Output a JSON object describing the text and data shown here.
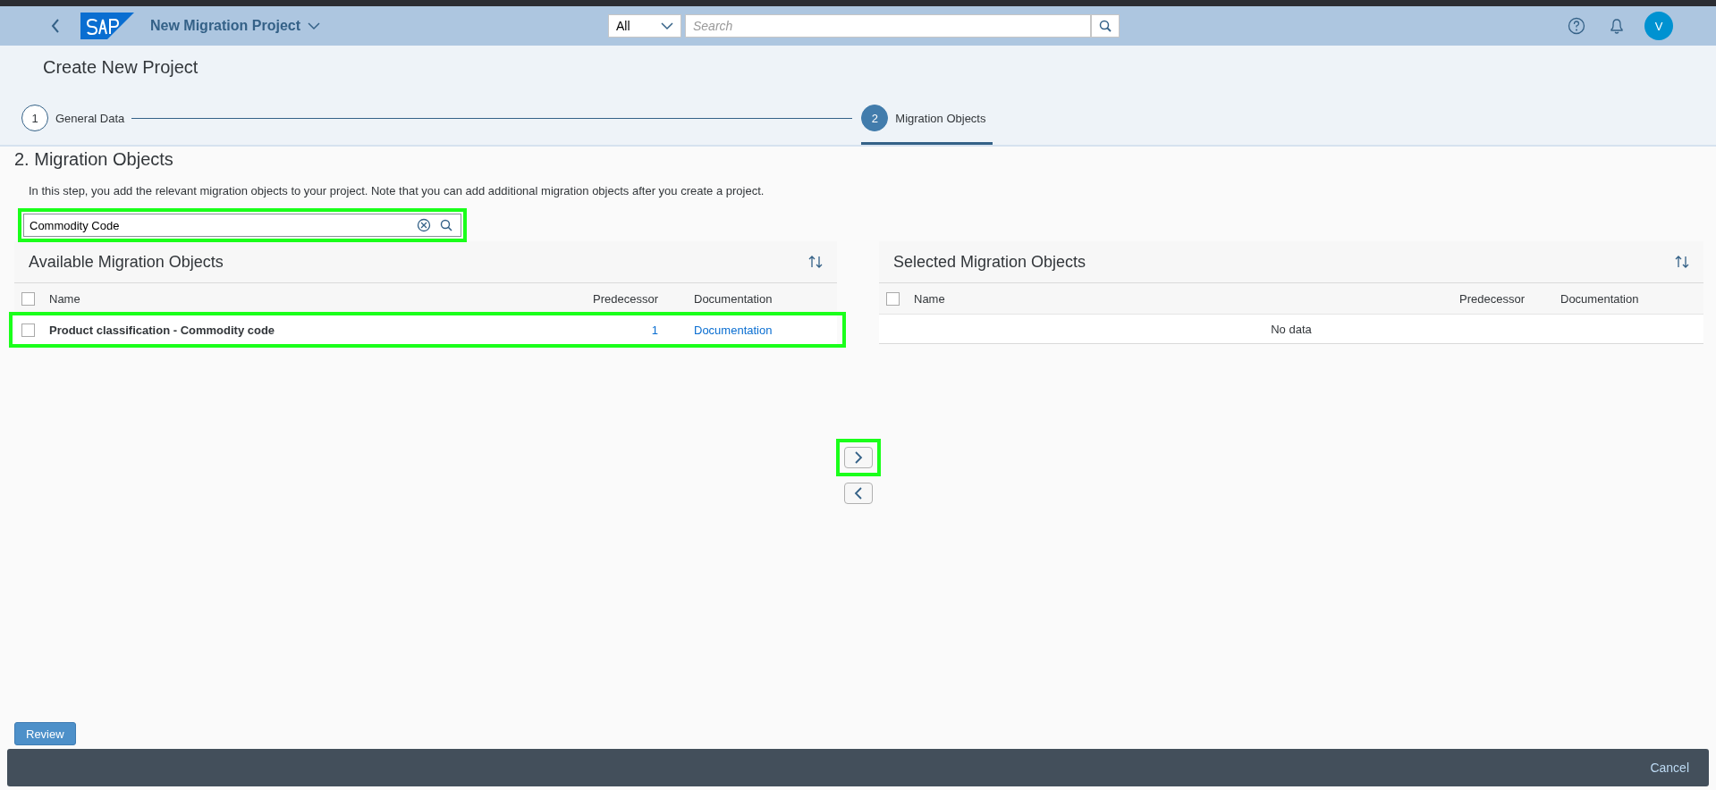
{
  "shell": {
    "title": "New Migration Project",
    "search_scope": "All",
    "search_placeholder": "Search",
    "avatar": "V"
  },
  "page_title": "Create New Project",
  "steps": [
    {
      "number": "1",
      "label": "General Data",
      "selected": false
    },
    {
      "number": "2",
      "label": "Migration Objects",
      "selected": true
    }
  ],
  "section": {
    "title": "2. Migration Objects",
    "description": "In this step, you add the relevant migration objects to your project. Note that you can add additional migration objects after you create a project."
  },
  "filter": {
    "value": "Commodity Code",
    "highlighted": true
  },
  "available": {
    "title": "Available Migration Objects",
    "columns": [
      "Name",
      "Predecessor",
      "Documentation"
    ],
    "all_checked": false,
    "rows": [
      {
        "name": "Product classification - Commodity code",
        "predecessor": "1",
        "documentation": "Documentation",
        "checked": false,
        "highlighted": true
      }
    ]
  },
  "selected": {
    "title": "Selected Migration Objects",
    "columns": [
      "Name",
      "Predecessor",
      "Documentation"
    ],
    "all_checked": false,
    "no_data": "No data"
  },
  "move_buttons": [
    {
      "kind": "add",
      "highlighted": true
    },
    {
      "kind": "remove",
      "highlighted": false
    }
  ],
  "footer": {
    "review": "Review",
    "cancel": "Cancel"
  }
}
